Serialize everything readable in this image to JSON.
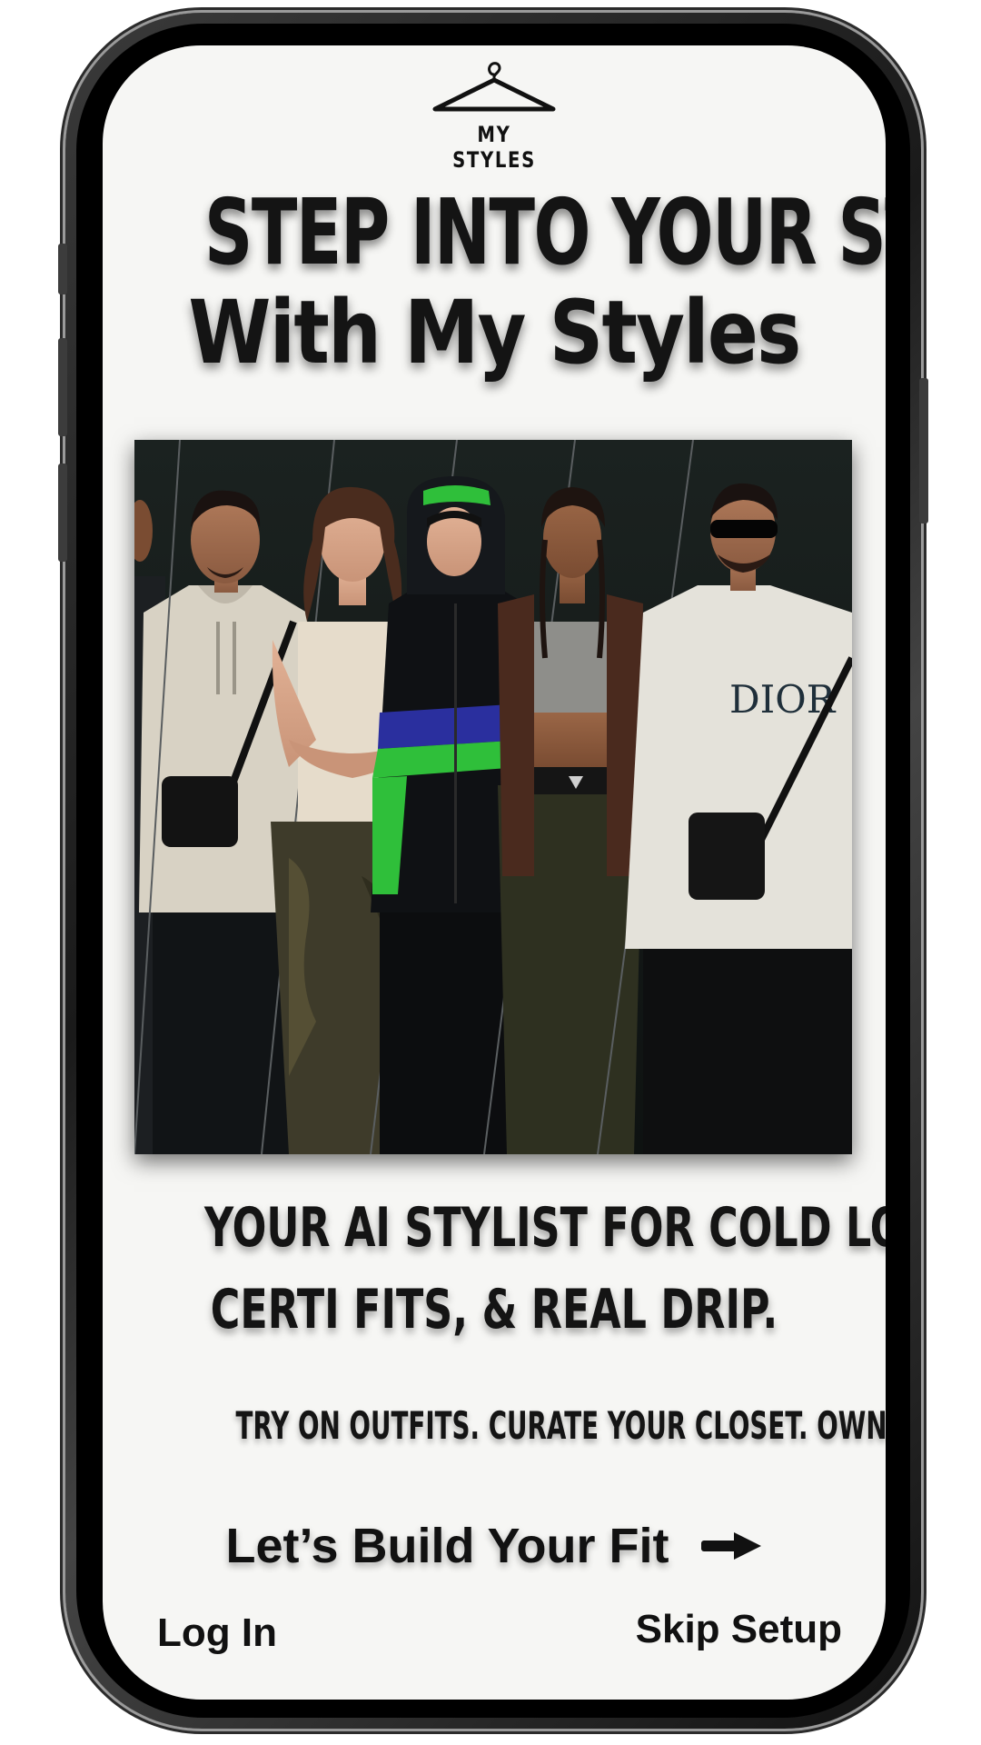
{
  "brand": {
    "logo_text": "MY  STYLES",
    "logo_icon": "hanger-icon"
  },
  "headline": {
    "line1": "STEP INTO YOUR STYLE",
    "line2": "With My Styles"
  },
  "hero": {
    "description": "collage-of-five-models",
    "shirt_print": "DIOR"
  },
  "tagline": {
    "line1": "YOUR AI STYLIST FOR COLD LOOKS,",
    "line2": "CERTI FITS, & REAL DRIP."
  },
  "subtagline": "TRY ON OUTFITS. CURATE YOUR CLOSET. OWN YOUR VIBE.",
  "cta": {
    "label": "Let’s Build Your Fit",
    "icon": "arrow-right-icon"
  },
  "footer": {
    "login_label": "Log In",
    "skip_label": "Skip Setup"
  },
  "colors": {
    "screen_bg": "#f6f6f4",
    "text": "#141414",
    "accent_green": "#2fbf3a",
    "accent_blue": "#2a2f9e",
    "photo_bg": "#121615"
  }
}
